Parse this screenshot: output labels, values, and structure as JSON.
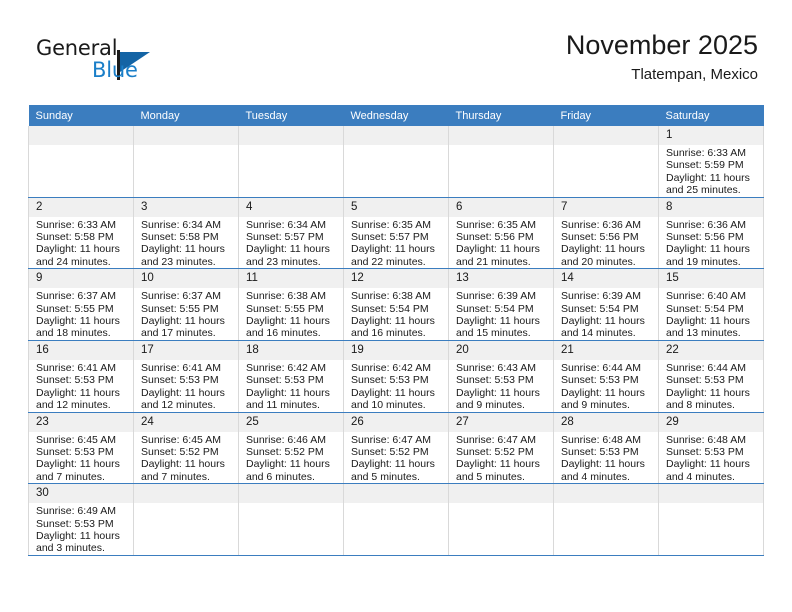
{
  "brand": {
    "word1": "General",
    "word2": "Blue",
    "flag_icon": "blue-flag-logo",
    "accent_color": "#1a7ec8",
    "flag_color": "#1464a5"
  },
  "header": {
    "title": "November 2025",
    "subtitle": "Tlatempan, Mexico",
    "header_bg_color": "#3b7dbf",
    "daynum_bg_color": "#f0f0f0"
  },
  "weekdays": [
    "Sunday",
    "Monday",
    "Tuesday",
    "Wednesday",
    "Thursday",
    "Friday",
    "Saturday"
  ],
  "labels": {
    "sunrise": "Sunrise:",
    "sunset": "Sunset:",
    "daylight": "Daylight:"
  },
  "weeks": [
    [
      {
        "day": ""
      },
      {
        "day": ""
      },
      {
        "day": ""
      },
      {
        "day": ""
      },
      {
        "day": ""
      },
      {
        "day": ""
      },
      {
        "day": "1",
        "sunrise": "Sunrise: 6:33 AM",
        "sunset": "Sunset: 5:59 PM",
        "daylight1": "Daylight: 11 hours",
        "daylight2": "and 25 minutes."
      }
    ],
    [
      {
        "day": "2",
        "sunrise": "Sunrise: 6:33 AM",
        "sunset": "Sunset: 5:58 PM",
        "daylight1": "Daylight: 11 hours",
        "daylight2": "and 24 minutes."
      },
      {
        "day": "3",
        "sunrise": "Sunrise: 6:34 AM",
        "sunset": "Sunset: 5:58 PM",
        "daylight1": "Daylight: 11 hours",
        "daylight2": "and 23 minutes."
      },
      {
        "day": "4",
        "sunrise": "Sunrise: 6:34 AM",
        "sunset": "Sunset: 5:57 PM",
        "daylight1": "Daylight: 11 hours",
        "daylight2": "and 23 minutes."
      },
      {
        "day": "5",
        "sunrise": "Sunrise: 6:35 AM",
        "sunset": "Sunset: 5:57 PM",
        "daylight1": "Daylight: 11 hours",
        "daylight2": "and 22 minutes."
      },
      {
        "day": "6",
        "sunrise": "Sunrise: 6:35 AM",
        "sunset": "Sunset: 5:56 PM",
        "daylight1": "Daylight: 11 hours",
        "daylight2": "and 21 minutes."
      },
      {
        "day": "7",
        "sunrise": "Sunrise: 6:36 AM",
        "sunset": "Sunset: 5:56 PM",
        "daylight1": "Daylight: 11 hours",
        "daylight2": "and 20 minutes."
      },
      {
        "day": "8",
        "sunrise": "Sunrise: 6:36 AM",
        "sunset": "Sunset: 5:56 PM",
        "daylight1": "Daylight: 11 hours",
        "daylight2": "and 19 minutes."
      }
    ],
    [
      {
        "day": "9",
        "sunrise": "Sunrise: 6:37 AM",
        "sunset": "Sunset: 5:55 PM",
        "daylight1": "Daylight: 11 hours",
        "daylight2": "and 18 minutes."
      },
      {
        "day": "10",
        "sunrise": "Sunrise: 6:37 AM",
        "sunset": "Sunset: 5:55 PM",
        "daylight1": "Daylight: 11 hours",
        "daylight2": "and 17 minutes."
      },
      {
        "day": "11",
        "sunrise": "Sunrise: 6:38 AM",
        "sunset": "Sunset: 5:55 PM",
        "daylight1": "Daylight: 11 hours",
        "daylight2": "and 16 minutes."
      },
      {
        "day": "12",
        "sunrise": "Sunrise: 6:38 AM",
        "sunset": "Sunset: 5:54 PM",
        "daylight1": "Daylight: 11 hours",
        "daylight2": "and 16 minutes."
      },
      {
        "day": "13",
        "sunrise": "Sunrise: 6:39 AM",
        "sunset": "Sunset: 5:54 PM",
        "daylight1": "Daylight: 11 hours",
        "daylight2": "and 15 minutes."
      },
      {
        "day": "14",
        "sunrise": "Sunrise: 6:39 AM",
        "sunset": "Sunset: 5:54 PM",
        "daylight1": "Daylight: 11 hours",
        "daylight2": "and 14 minutes."
      },
      {
        "day": "15",
        "sunrise": "Sunrise: 6:40 AM",
        "sunset": "Sunset: 5:54 PM",
        "daylight1": "Daylight: 11 hours",
        "daylight2": "and 13 minutes."
      }
    ],
    [
      {
        "day": "16",
        "sunrise": "Sunrise: 6:41 AM",
        "sunset": "Sunset: 5:53 PM",
        "daylight1": "Daylight: 11 hours",
        "daylight2": "and 12 minutes."
      },
      {
        "day": "17",
        "sunrise": "Sunrise: 6:41 AM",
        "sunset": "Sunset: 5:53 PM",
        "daylight1": "Daylight: 11 hours",
        "daylight2": "and 12 minutes."
      },
      {
        "day": "18",
        "sunrise": "Sunrise: 6:42 AM",
        "sunset": "Sunset: 5:53 PM",
        "daylight1": "Daylight: 11 hours",
        "daylight2": "and 11 minutes."
      },
      {
        "day": "19",
        "sunrise": "Sunrise: 6:42 AM",
        "sunset": "Sunset: 5:53 PM",
        "daylight1": "Daylight: 11 hours",
        "daylight2": "and 10 minutes."
      },
      {
        "day": "20",
        "sunrise": "Sunrise: 6:43 AM",
        "sunset": "Sunset: 5:53 PM",
        "daylight1": "Daylight: 11 hours",
        "daylight2": "and 9 minutes."
      },
      {
        "day": "21",
        "sunrise": "Sunrise: 6:44 AM",
        "sunset": "Sunset: 5:53 PM",
        "daylight1": "Daylight: 11 hours",
        "daylight2": "and 9 minutes."
      },
      {
        "day": "22",
        "sunrise": "Sunrise: 6:44 AM",
        "sunset": "Sunset: 5:53 PM",
        "daylight1": "Daylight: 11 hours",
        "daylight2": "and 8 minutes."
      }
    ],
    [
      {
        "day": "23",
        "sunrise": "Sunrise: 6:45 AM",
        "sunset": "Sunset: 5:53 PM",
        "daylight1": "Daylight: 11 hours",
        "daylight2": "and 7 minutes."
      },
      {
        "day": "24",
        "sunrise": "Sunrise: 6:45 AM",
        "sunset": "Sunset: 5:52 PM",
        "daylight1": "Daylight: 11 hours",
        "daylight2": "and 7 minutes."
      },
      {
        "day": "25",
        "sunrise": "Sunrise: 6:46 AM",
        "sunset": "Sunset: 5:52 PM",
        "daylight1": "Daylight: 11 hours",
        "daylight2": "and 6 minutes."
      },
      {
        "day": "26",
        "sunrise": "Sunrise: 6:47 AM",
        "sunset": "Sunset: 5:52 PM",
        "daylight1": "Daylight: 11 hours",
        "daylight2": "and 5 minutes."
      },
      {
        "day": "27",
        "sunrise": "Sunrise: 6:47 AM",
        "sunset": "Sunset: 5:52 PM",
        "daylight1": "Daylight: 11 hours",
        "daylight2": "and 5 minutes."
      },
      {
        "day": "28",
        "sunrise": "Sunrise: 6:48 AM",
        "sunset": "Sunset: 5:53 PM",
        "daylight1": "Daylight: 11 hours",
        "daylight2": "and 4 minutes."
      },
      {
        "day": "29",
        "sunrise": "Sunrise: 6:48 AM",
        "sunset": "Sunset: 5:53 PM",
        "daylight1": "Daylight: 11 hours",
        "daylight2": "and 4 minutes."
      }
    ],
    [
      {
        "day": "30",
        "sunrise": "Sunrise: 6:49 AM",
        "sunset": "Sunset: 5:53 PM",
        "daylight1": "Daylight: 11 hours",
        "daylight2": "and 3 minutes."
      },
      {
        "day": ""
      },
      {
        "day": ""
      },
      {
        "day": ""
      },
      {
        "day": ""
      },
      {
        "day": ""
      },
      {
        "day": ""
      }
    ]
  ]
}
